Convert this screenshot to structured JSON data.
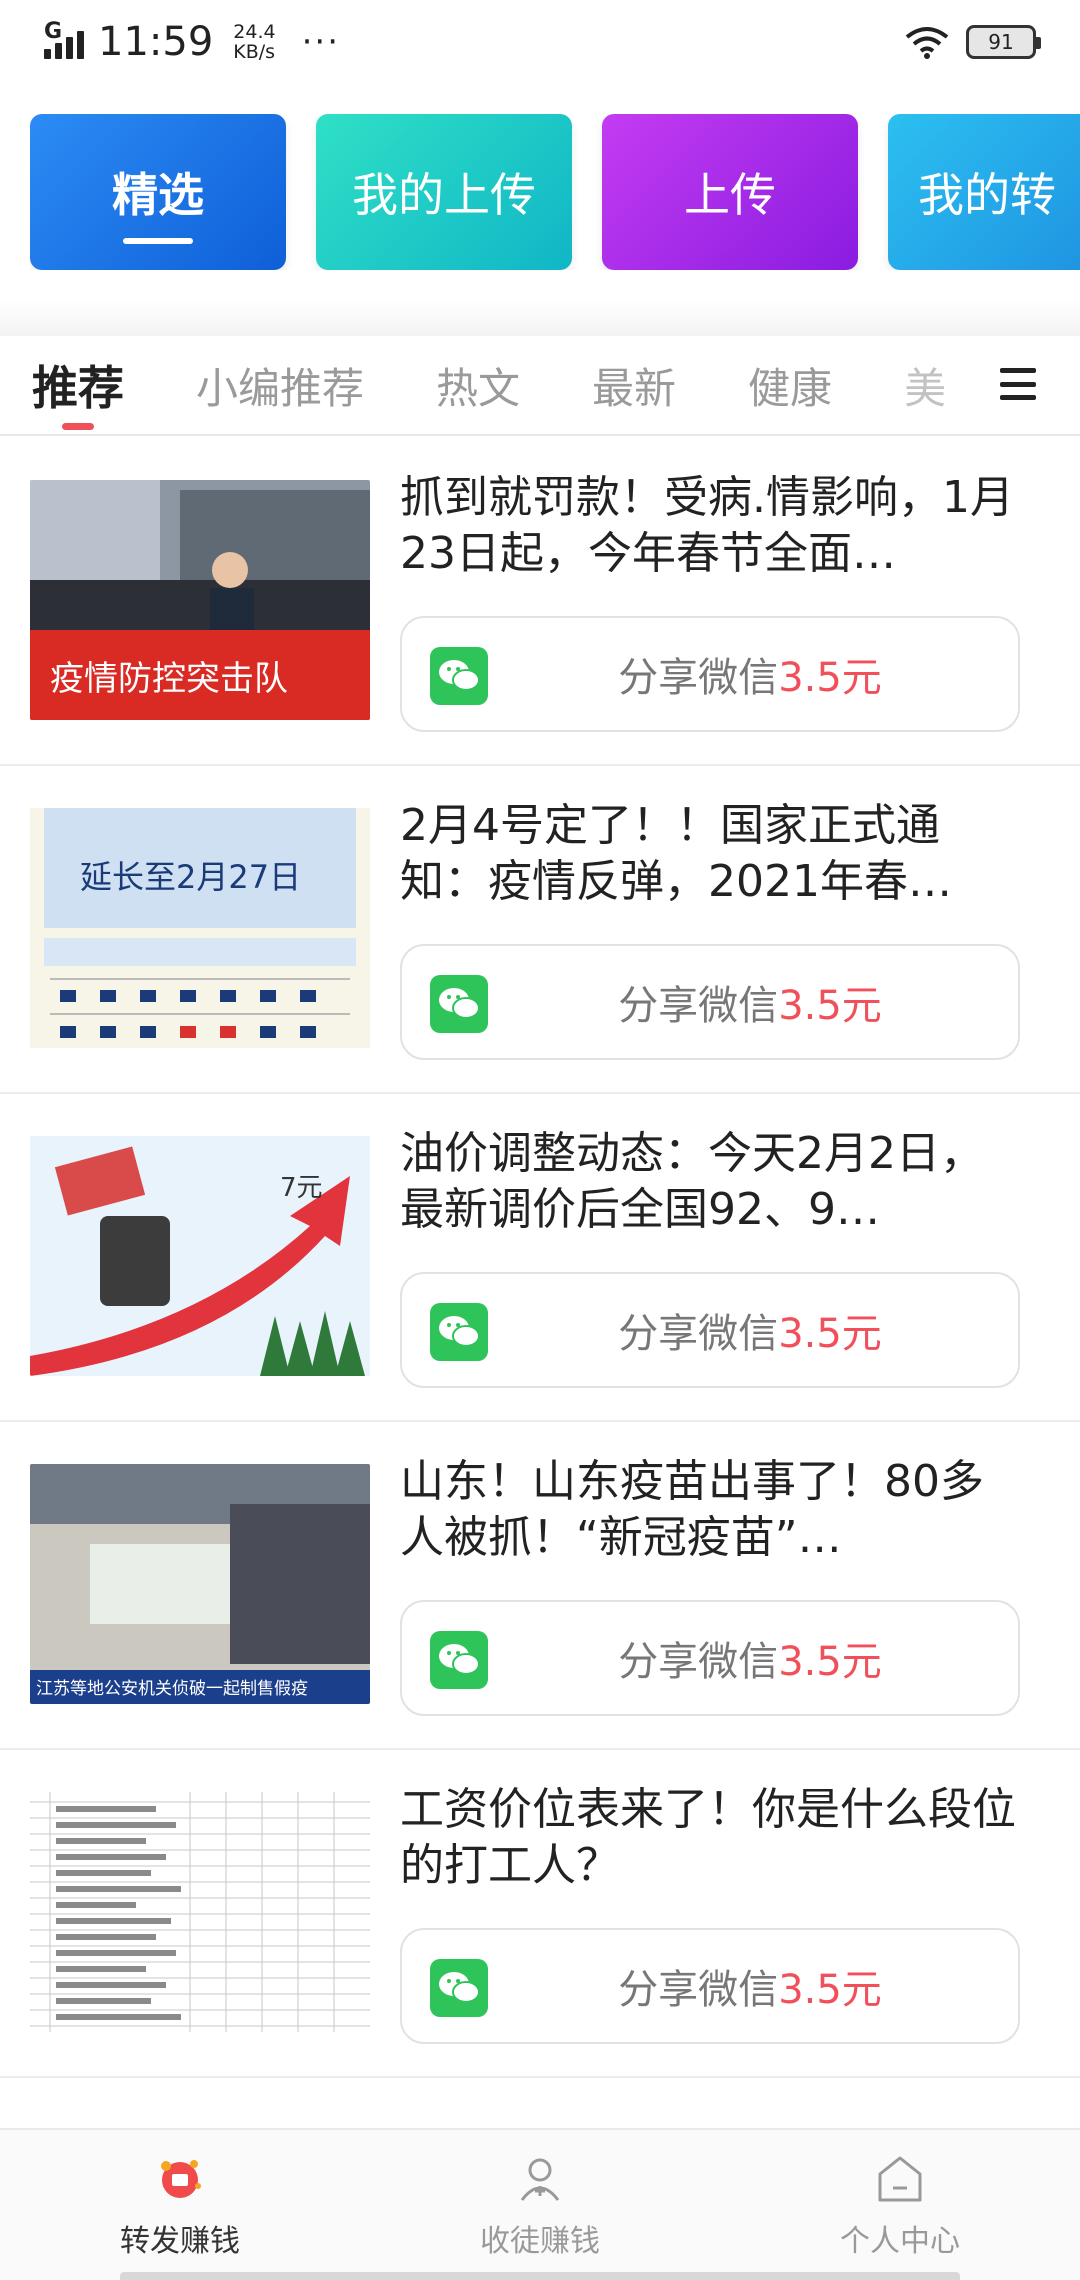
{
  "status_bar": {
    "signal_label": "G",
    "time": "11:59",
    "speed_value": "24.4",
    "speed_unit": "KB/s",
    "more": "···",
    "battery": "91"
  },
  "top_cards": [
    {
      "label": "精选",
      "selected": true
    },
    {
      "label": "我的上传"
    },
    {
      "label": "上传"
    },
    {
      "label": "我的转"
    }
  ],
  "category_tabs": [
    {
      "label": "推荐",
      "active": true
    },
    {
      "label": "小编推荐"
    },
    {
      "label": "热文"
    },
    {
      "label": "最新"
    },
    {
      "label": "健康"
    },
    {
      "label": "美"
    }
  ],
  "articles": [
    {
      "title": "抓到就罚款！受病.情影响，1月23日起，今年春节全面…",
      "share_label": "分享微信",
      "share_amount": "3.5元",
      "thumb_caption": "疫情防控突击队"
    },
    {
      "title": "2月4号定了！！国家正式通知：疫情反弹，2021年春…",
      "share_label": "分享微信",
      "share_amount": "3.5元",
      "thumb_caption": "延长至2月27日"
    },
    {
      "title": "油价调整动态：今天2月2日，最新调价后全国92、9…",
      "share_label": "分享微信",
      "share_amount": "3.5元",
      "thumb_caption": "7元"
    },
    {
      "title": "山东！山东疫苗出事了！80多人被抓！“新冠疫苗”…",
      "share_label": "分享微信",
      "share_amount": "3.5元",
      "thumb_caption": "江苏等地公安机关侦破一起制售假疫"
    },
    {
      "title": " 工资价位表来了！你是什么段位的打工人？",
      "share_label": "分享微信",
      "share_amount": "3.5元",
      "thumb_caption": ""
    }
  ],
  "bottom_nav": [
    {
      "label": "转发赚钱",
      "icon": "forward-earn-icon",
      "active": true
    },
    {
      "label": "收徒赚钱",
      "icon": "recruit-icon"
    },
    {
      "label": "个人中心",
      "icon": "home-profile-icon"
    }
  ],
  "colors": {
    "accent": "#f0505a",
    "wechat": "#2fc45a"
  }
}
